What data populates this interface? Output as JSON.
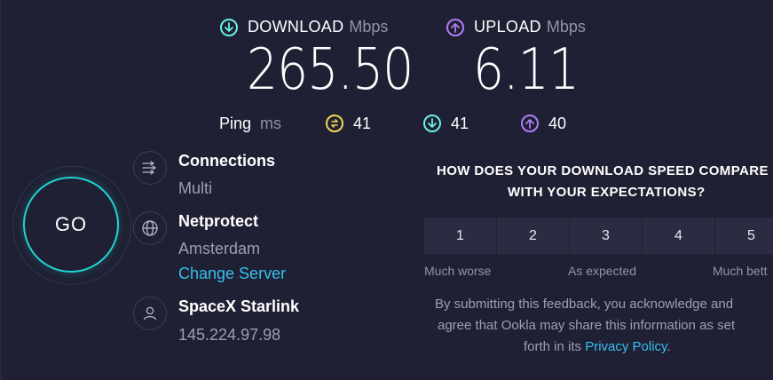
{
  "download": {
    "label": "DOWNLOAD",
    "unit": "Mbps",
    "value": "265.50",
    "color": "#6af0e3"
  },
  "upload": {
    "label": "UPLOAD",
    "unit": "Mbps",
    "value": "6.11",
    "color": "#b27cf5"
  },
  "ping": {
    "label": "Ping",
    "unit": "ms",
    "idle": "41",
    "download": "41",
    "upload": "40",
    "idle_color": "#f3d64e"
  },
  "go_label": "GO",
  "connections": {
    "title": "Connections",
    "value": "Multi"
  },
  "server": {
    "title": "Netprotect",
    "location": "Amsterdam",
    "change_label": "Change Server"
  },
  "provider": {
    "title": "SpaceX Starlink",
    "ip": "145.224.97.98"
  },
  "survey": {
    "question_line1": "HOW DOES YOUR DOWNLOAD SPEED COMPARE",
    "question_line2": "WITH YOUR EXPECTATIONS?",
    "options": [
      "1",
      "2",
      "3",
      "4",
      "5"
    ],
    "low_label": "Much worse",
    "mid_label": "As expected",
    "high_label": "Much bett",
    "disclaimer_line1": "By submitting this feedback, you acknowledge and",
    "disclaimer_line2": "agree that Ookla may share this information as set",
    "disclaimer_line3_prefix": "forth in its ",
    "privacy_link": "Privacy Policy",
    "disclaimer_line3_suffix": "."
  },
  "accent_color": "#38bff0"
}
